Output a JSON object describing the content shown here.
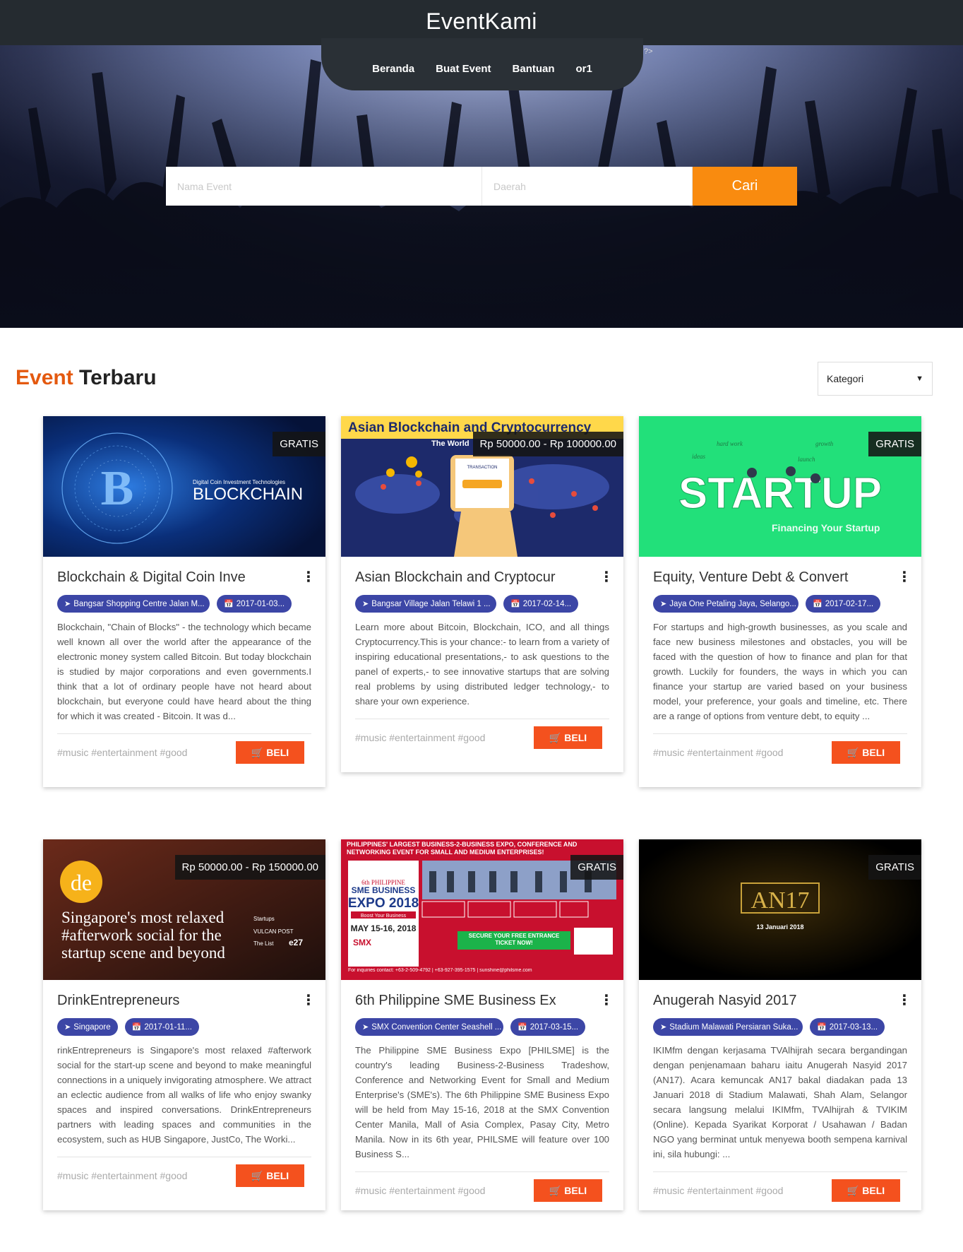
{
  "header": {
    "brand": "EventKami",
    "nav": [
      "Beranda",
      "Buat Event",
      "Bantuan",
      "or1"
    ],
    "stray_text": "?>"
  },
  "search": {
    "name_placeholder": "Nama Event",
    "region_placeholder": "Daerah",
    "button_label": "Cari"
  },
  "section": {
    "title_accent": "Event",
    "title_rest": "Terbaru",
    "category_select": "Kategori"
  },
  "cards": [
    {
      "image_text": [
        "Digital Coin Investment Technologies",
        "BLOCKCHAIN"
      ],
      "price": "GRATIS",
      "title": "Blockchain & Digital Coin Inve",
      "location": "Bangsar Shopping Centre Jalan M...",
      "date": "2017-01-03...",
      "description": "Blockchain, \"Chain of Blocks\" - the technology which became well known all over the world after the appearance of the electronic money system called Bitcoin. But today blockchain is studied by major corporations and even governments.I think that a lot of ordinary people have not heard about blockchain, but everyone could have heard about the thing for which it was created - Bitcoin. It was d...",
      "tags": "#music #entertainment #good",
      "buy_label": "BELI"
    },
    {
      "image_text": [
        "Asian Blockchain and Cryptocurrency",
        "The World",
        "TRANSACTION"
      ],
      "price": "Rp 50000.00 - Rp 100000.00",
      "title": "Asian Blockchain and Cryptocur",
      "location": "Bangsar Village Jalan Telawi 1 ...",
      "date": "2017-02-14...",
      "description": "Learn more about Bitcoin, Blockchain, ICO, and all things Cryptocurrency.This is your chance:- to learn from a variety of inspiring educational presentations,- to ask questions to the panel of experts,- to see innovative startups that are solving real problems by using distributed ledger technology,- to share your own experience.",
      "tags": "#music #entertainment #good",
      "buy_label": "BELI"
    },
    {
      "image_text": [
        "STARTUP",
        "Financing Your Startup",
        "hard work",
        "growth",
        "ideas",
        "launch"
      ],
      "price": "GRATIS",
      "title": "Equity, Venture Debt & Convert",
      "location": "Jaya One Petaling Jaya, Selango...",
      "date": "2017-02-17...",
      "description": "For startups and high-growth businesses, as you scale and face new business milestones and obstacles, you will be faced with the question of how to finance and plan for that growth. Luckily for founders, the ways in which you can finance your startup are varied based on your business model, your preference, your goals and timeline, etc. There are a range of options from venture debt, to equity ...",
      "tags": "#music #entertainment #good",
      "buy_label": "BELI"
    },
    {
      "image_text": [
        "de",
        "Singapore's most relaxed",
        "#afterwork social for the",
        "startup scene and beyond",
        "Startups",
        "VULCAN POST",
        "The List",
        "e27"
      ],
      "price": "Rp 50000.00 - Rp 150000.00",
      "title": "DrinkEntrepreneurs",
      "location": "Singapore",
      "date": "2017-01-11...",
      "description": "rinkEntrepreneurs is Singapore's most relaxed #afterwork social for the start-up scene and beyond to make meaningful connections in a uniquely invigorating atmosphere. We attract an eclectic audience from all walks of life who enjoy swanky spaces and inspired conversations. DrinkEntrepreneurs partners with leading spaces and communities in the ecosystem, such as HUB Singapore, JustCo, The Worki...",
      "tags": "#music #entertainment #good",
      "buy_label": "BELI"
    },
    {
      "image_text": [
        "PHILIPPINES' LARGEST BUSINESS-2-BUSINESS EXPO, CONFERENCE AND NETWORKING EVENT FOR SMALL AND MEDIUM ENTERPRISES!",
        "6th PHILIPPINE",
        "SME BUSINESS",
        "EXPO 2018",
        "Boost Your Business",
        "MAY 15-16, 2018",
        "SMX",
        "SECURE YOUR FREE ENTRANCE TICKET NOW!",
        "For inquiries contact: +63-2-509-4792 | +63-927-395-1575 | sunshine@philsme.com"
      ],
      "price": "GRATIS",
      "title": "6th Philippine SME Business Ex",
      "location": "SMX Convention Center Seashell ...",
      "date": "2017-03-15...",
      "description": "The Philippine SME Business Expo [PHILSME] is the country's leading Business-2-Business Tradeshow, Conference and Networking Event for Small and Medium Enterprise's (SME's). The 6th Philippine SME Business Expo will be held from May 15-16, 2018 at the SMX Convention Center Manila, Mall of Asia Complex, Pasay City, Metro Manila. Now in its 6th year, PHILSME will feature over 100 Business S...",
      "tags": "#music #entertainment #good",
      "buy_label": "BELI"
    },
    {
      "image_text": [
        "AN17",
        "13 Januari 2018"
      ],
      "price": "GRATIS",
      "title": "Anugerah Nasyid 2017",
      "location": "Stadium Malawati Persiaran Suka...",
      "date": "2017-03-13...",
      "description": "IKIMfm dengan kerjasama TVAlhijrah secara bergandingan dengan penjenamaan baharu iaitu Anugerah Nasyid 2017 (AN17). Acara kemuncak AN17 bakal diadakan pada 13 Januari 2018 di Stadium Malawati, Shah Alam, Selangor secara langsung melalui IKIMfm, TVAlhijrah & TVIKIM (Online). Kepada Syarikat Korporat / Usahawan / Badan NGO yang berminat untuk menyewa booth sempena karnival ini, sila hubungi: ...",
      "tags": "#music #entertainment #good",
      "buy_label": "BELI"
    }
  ],
  "colors": {
    "topbar": "#252b30",
    "accent_orange": "#f98b0f",
    "section_accent": "#e4590f",
    "buy_button": "#f4511e",
    "chip": "#3c46a6"
  },
  "icons": {
    "location": "location-arrow-icon",
    "date": "calendar-check-icon",
    "buy": "shopping-cart-icon",
    "menu": "more-vert-icon",
    "select": "caret-down-icon"
  }
}
